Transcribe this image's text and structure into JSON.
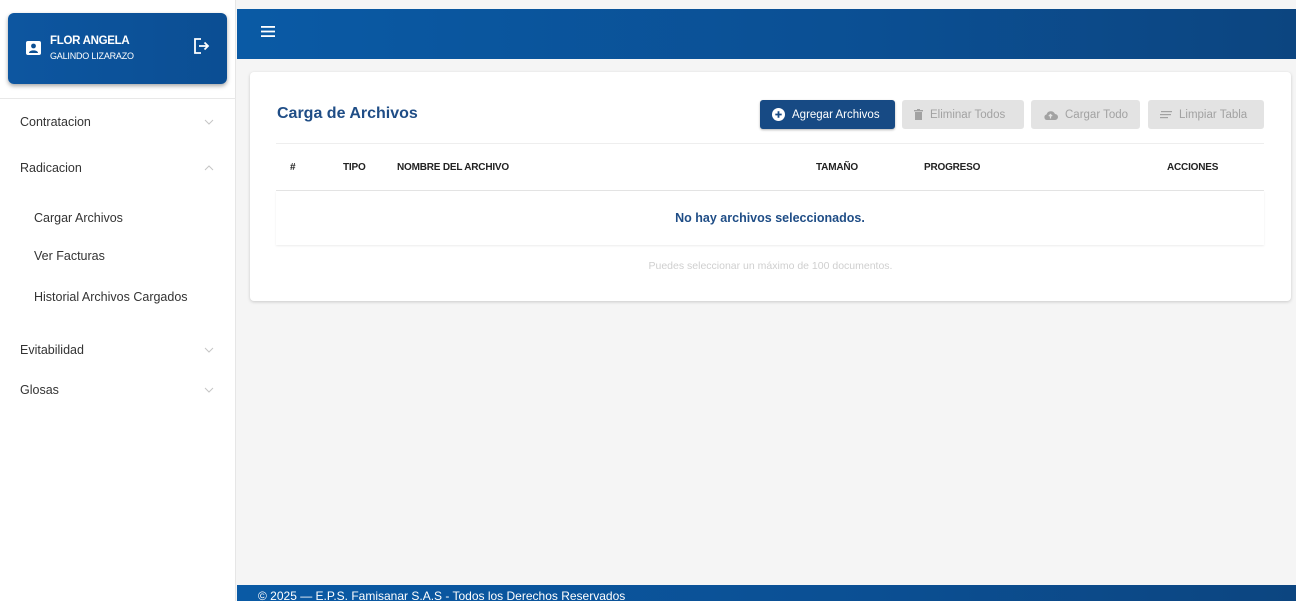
{
  "user": {
    "first_name": "FLOR ANGELA",
    "last_name": "GALINDO LIZARAZO"
  },
  "sidebar": {
    "items": [
      {
        "label": "Contratacion",
        "expanded": false
      },
      {
        "label": "Radicacion",
        "expanded": true
      },
      {
        "label": "Evitabilidad",
        "expanded": false
      },
      {
        "label": "Glosas",
        "expanded": false
      }
    ],
    "radicacion_sub": [
      {
        "label": "Cargar Archivos"
      },
      {
        "label": "Ver Facturas"
      },
      {
        "label": "Historial Archivos Cargados"
      }
    ]
  },
  "card": {
    "title": "Carga de Archivos",
    "buttons": {
      "add": "Agregar Archivos",
      "delete_all": "Eliminar Todos",
      "upload_all": "Cargar Todo",
      "clear_table": "Limpiar Tabla"
    },
    "columns": [
      "#",
      "TIPO",
      "NOMBRE DEL ARCHIVO",
      "TAMAÑO",
      "PROGRESO",
      "ACCIONES"
    ],
    "empty_message": "No hay archivos seleccionados.",
    "hint": "Puedes seleccionar un máximo de 100 documentos."
  },
  "footer": {
    "text": "© 2025 — E.P.S. Famisanar S.A.S - Todos los Derechos Reservados"
  },
  "colors": {
    "brand_blue": "#0b4f93",
    "title_blue": "#1f4d86",
    "button_primary": "#174a84"
  }
}
